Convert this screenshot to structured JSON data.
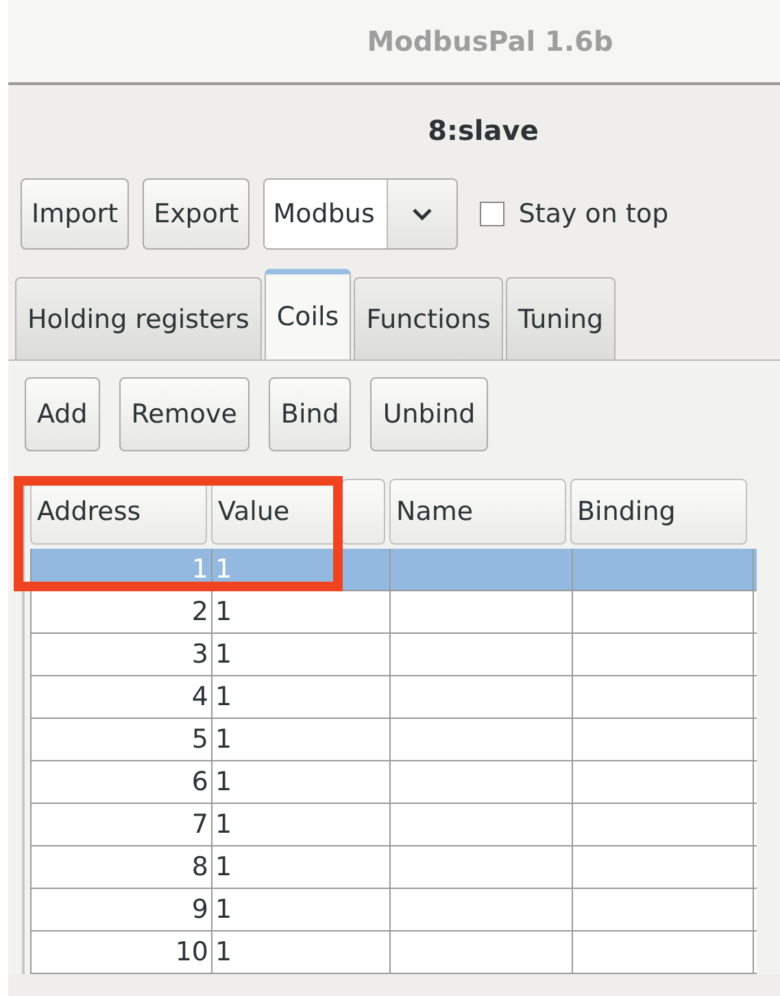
{
  "app_window": {
    "title": "ModbusPal 1.6b"
  },
  "slave_window": {
    "title": "8:slave"
  },
  "toolbar": {
    "buttons": [
      "Import",
      "Export"
    ],
    "format_select": {
      "value": "Modbus"
    },
    "stay_on_top": {
      "label": "Stay on top",
      "checked": false
    }
  },
  "tabs": [
    {
      "label": "Holding registers",
      "selected": false
    },
    {
      "label": "Coils",
      "selected": true
    },
    {
      "label": "Functions",
      "selected": false
    },
    {
      "label": "Tuning",
      "selected": false
    }
  ],
  "actions": [
    "Add",
    "Remove",
    "Bind",
    "Unbind"
  ],
  "table": {
    "columns": [
      "Address",
      "Value",
      "Name",
      "Binding"
    ],
    "rows": [
      {
        "address": "1",
        "value": "1",
        "selected": true
      },
      {
        "address": "2",
        "value": "1",
        "selected": false
      },
      {
        "address": "3",
        "value": "1",
        "selected": false
      },
      {
        "address": "4",
        "value": "1",
        "selected": false
      },
      {
        "address": "5",
        "value": "1",
        "selected": false
      },
      {
        "address": "6",
        "value": "1",
        "selected": false
      },
      {
        "address": "7",
        "value": "1",
        "selected": false
      },
      {
        "address": "8",
        "value": "1",
        "selected": false
      },
      {
        "address": "9",
        "value": "1",
        "selected": false
      },
      {
        "address": "10",
        "value": "1",
        "selected": false
      }
    ]
  }
}
